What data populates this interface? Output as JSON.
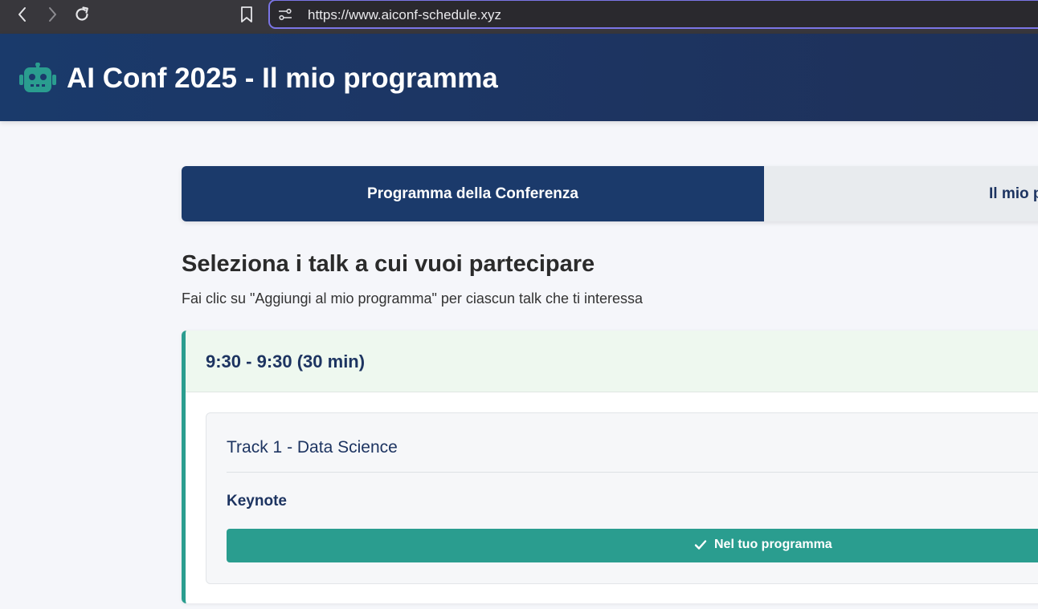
{
  "browser": {
    "url": "https://www.aiconf-schedule.xyz",
    "icons": [
      "back-icon",
      "forward-icon",
      "reload-icon",
      "bookmark-icon",
      "site-info-icon"
    ]
  },
  "header": {
    "logo_icon": "robot-icon",
    "title": "AI Conf 2025 - Il mio programma"
  },
  "tabs": [
    {
      "label": "Programma della Conferenza",
      "active": true
    },
    {
      "label": "Il mio p",
      "active": false
    }
  ],
  "section": {
    "title": "Seleziona i talk a cui vuoi partecipare",
    "subtitle": "Fai clic su \"Aggiungi al mio programma\" per ciascun talk che ti interessa"
  },
  "slots": [
    {
      "time": "9:30 - 9:30 (30 min)",
      "talks": [
        {
          "track": "Track 1 - Data Science",
          "title": "Keynote",
          "button_label": "Nel tuo programma",
          "button_icon": "check-icon"
        }
      ]
    }
  ],
  "colors": {
    "header_bg": "#1b3a6b",
    "accent": "#2a9d8f",
    "slot_head_bg": "#eef8ef",
    "url_focus": "#7b75e6"
  }
}
